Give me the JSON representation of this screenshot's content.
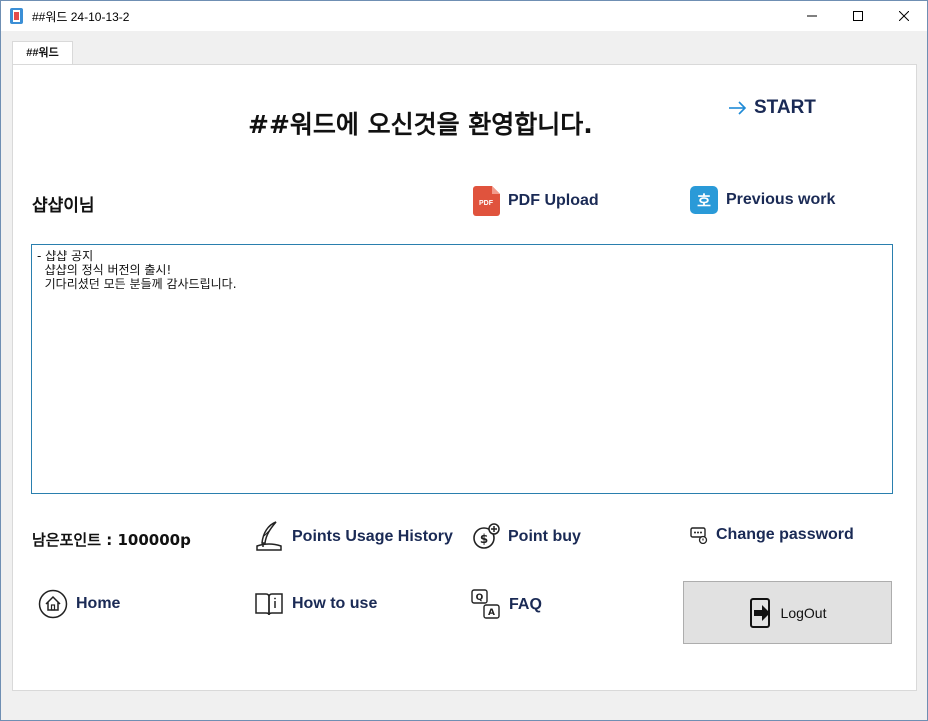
{
  "window": {
    "title": "##워드 24-10-13-2",
    "tab_label": "##워드"
  },
  "header": {
    "headline": "##워드에 오신것을 환영합니다.",
    "start_label": "START"
  },
  "user": {
    "name": "샵샵이님"
  },
  "actions": {
    "pdf_upload": "PDF Upload",
    "previous_work": "Previous work"
  },
  "notice": {
    "lines": [
      "- 샵샵 공지",
      "  샵샵의 정식 버전의 출시!",
      "  기다리셨던 모든 분들께 감사드립니다."
    ]
  },
  "footer": {
    "points_label": "남은포인트 : 100000p",
    "points_history": "Points Usage History",
    "point_buy": "Point buy",
    "change_password": "Change password",
    "home": "Home",
    "how_to_use": "How to use",
    "faq": "FAQ",
    "logout": "LogOut"
  },
  "colors": {
    "accent": "#1a2a55",
    "pdf_red": "#e0533d",
    "prev_blue": "#2a9ad8",
    "notice_border": "#2a7fae"
  },
  "icons": {
    "pdf": "pdf-icon",
    "previous": "previous-work-icon",
    "start": "arrow-right-icon"
  }
}
